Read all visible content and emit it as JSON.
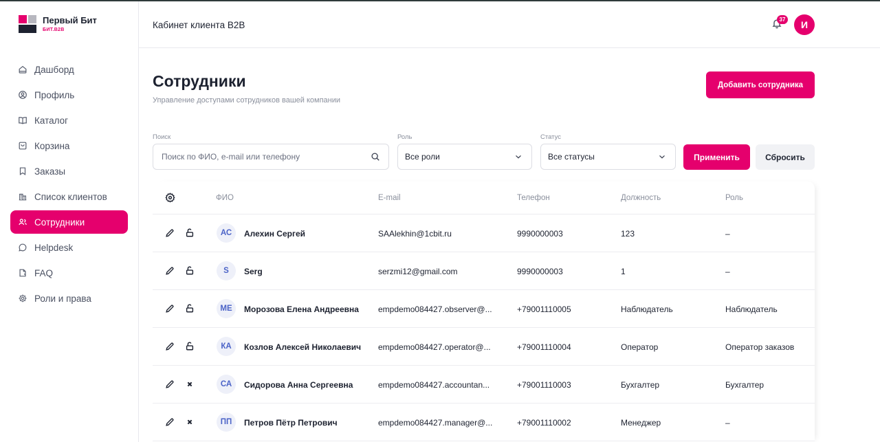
{
  "brand": {
    "name": "Первый Бит",
    "sub": "БИТ.B2B"
  },
  "sidebar": {
    "items": [
      {
        "label": "Дашборд",
        "icon": "home-icon"
      },
      {
        "label": "Профиль",
        "icon": "user-circle-icon"
      },
      {
        "label": "Каталог",
        "icon": "book-icon"
      },
      {
        "label": "Корзина",
        "icon": "cart-icon"
      },
      {
        "label": "Заказы",
        "icon": "bookmark-icon"
      },
      {
        "label": "Список клиентов",
        "icon": "buildings-icon"
      },
      {
        "label": "Сотрудники",
        "icon": "users-icon",
        "active": true
      },
      {
        "label": "Helpdesk",
        "icon": "chat-icon"
      },
      {
        "label": "FAQ",
        "icon": "document-icon"
      },
      {
        "label": "Роли и права",
        "icon": "gear-icon"
      }
    ]
  },
  "header": {
    "title": "Кабинет клиента B2B",
    "notifications": "37",
    "avatar": "И"
  },
  "main": {
    "title": "Сотрудники",
    "subtitle": "Управление доступами сотрудников вашей компании",
    "add_button": "Добавить сотрудника"
  },
  "filters": {
    "search_label": "Поиск",
    "search_placeholder": "Поиск по ФИО, e-mail или телефону",
    "role_label": "Роль",
    "role_value": "Все роли",
    "status_label": "Статус",
    "status_value": "Все статусы",
    "apply": "Применить",
    "reset": "Сбросить"
  },
  "table": {
    "columns": [
      "ФИО",
      "E-mail",
      "Телефон",
      "Должность",
      "Роль"
    ],
    "rows": [
      {
        "initials": "АС",
        "name": "Алехин Сергей",
        "email": "SAAlekhin@1cbit.ru",
        "phone": "9990000003",
        "position": "123",
        "role": "–",
        "action": "lock-open-icon"
      },
      {
        "initials": "S",
        "name": "Serg",
        "email": "serzmi12@gmail.com",
        "phone": "9990000003",
        "position": "1",
        "role": "–",
        "action": "lock-open-icon"
      },
      {
        "initials": "МЕ",
        "name": "Морозова Елена Андреевна",
        "email": "empdemo084427.observer@...",
        "phone": "+79001110005",
        "position": "Наблюдатель",
        "role": "Наблюдатель",
        "action": "lock-open-icon"
      },
      {
        "initials": "КА",
        "name": "Козлов Алексей Николаевич",
        "email": "empdemo084427.operator@...",
        "phone": "+79001110004",
        "position": "Оператор",
        "role": "Оператор заказов",
        "action": "lock-open-icon"
      },
      {
        "initials": "СА",
        "name": "Сидорова Анна Сергеевна",
        "email": "empdemo084427.accountan...",
        "phone": "+79001110003",
        "position": "Бухгалтер",
        "role": "Бухгалтер",
        "action": "close-icon"
      },
      {
        "initials": "ПП",
        "name": "Петров Пётр Петрович",
        "email": "empdemo084427.manager@...",
        "phone": "+79001110002",
        "position": "Менеджер",
        "role": "–",
        "action": "close-icon"
      }
    ]
  },
  "colors": {
    "accent": "#e5006d",
    "text": "#1d2230",
    "muted": "#8a8f9c",
    "initials_bg": "#eef0f9",
    "initials_fg": "#4b63c7"
  }
}
